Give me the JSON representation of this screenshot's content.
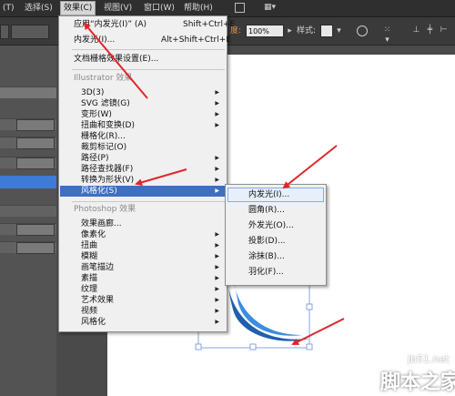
{
  "menubar": {
    "items": [
      {
        "label": "(T)",
        "active": false
      },
      {
        "label": "选择(S)",
        "active": false
      },
      {
        "label": "效果(C)",
        "active": true
      },
      {
        "label": "视图(V)",
        "active": false
      },
      {
        "label": "窗口(W)",
        "active": false
      },
      {
        "label": "帮助(H)",
        "active": false
      }
    ]
  },
  "control_bar": {
    "opacity_label": "度:",
    "opacity_value": "100%",
    "style_label": "样式:"
  },
  "effect_menu": {
    "apply_label": "应用“内发光(I)” (A)",
    "apply_shortcut": "Shift+Ctrl+E",
    "last_effect_label": "内发光(I)...",
    "last_effect_shortcut": "Alt+Shift+Ctrl+E",
    "doc_raster_label": "文档栅格效果设置(E)...",
    "illustrator_header": "Illustrator 效果",
    "illustrator_items": [
      {
        "label": "3D(3)",
        "submenu": true
      },
      {
        "label": "SVG 滤镜(G)",
        "submenu": true
      },
      {
        "label": "变形(W)",
        "submenu": true
      },
      {
        "label": "扭曲和变换(D)",
        "submenu": true
      },
      {
        "label": "栅格化(R)...",
        "submenu": false
      },
      {
        "label": "裁剪标记(O)",
        "submenu": false
      },
      {
        "label": "路径(P)",
        "submenu": true
      },
      {
        "label": "路径查找器(F)",
        "submenu": true
      },
      {
        "label": "转换为形状(V)",
        "submenu": true
      },
      {
        "label": "风格化(S)",
        "submenu": true
      }
    ],
    "photoshop_header": "Photoshop 效果",
    "photoshop_items": [
      {
        "label": "效果画廊...",
        "submenu": false
      },
      {
        "label": "像素化",
        "submenu": true
      },
      {
        "label": "扭曲",
        "submenu": true
      },
      {
        "label": "模糊",
        "submenu": true
      },
      {
        "label": "画笔描边",
        "submenu": true
      },
      {
        "label": "素描",
        "submenu": true
      },
      {
        "label": "纹理",
        "submenu": true
      },
      {
        "label": "艺术效果",
        "submenu": true
      },
      {
        "label": "视频",
        "submenu": true
      },
      {
        "label": "风格化",
        "submenu": true
      }
    ]
  },
  "stylize_submenu": {
    "items": [
      {
        "label": "内发光(I)..."
      },
      {
        "label": "圆角(R)..."
      },
      {
        "label": "外发光(O)..."
      },
      {
        "label": "投影(D)..."
      },
      {
        "label": "涂抹(B)..."
      },
      {
        "label": "羽化(F)..."
      }
    ]
  },
  "watermark": {
    "site": "jb51.net",
    "name": "脚本之家"
  },
  "colors": {
    "highlight": "#3d6fc4",
    "arrow": "#e0262b",
    "shape_dark": "#1f5fae",
    "shape_light": "#3a8ee0"
  },
  "icons": [
    "menu-arrow-icon",
    "dropdown-chevron-icon",
    "globe-icon",
    "align-icon"
  ]
}
